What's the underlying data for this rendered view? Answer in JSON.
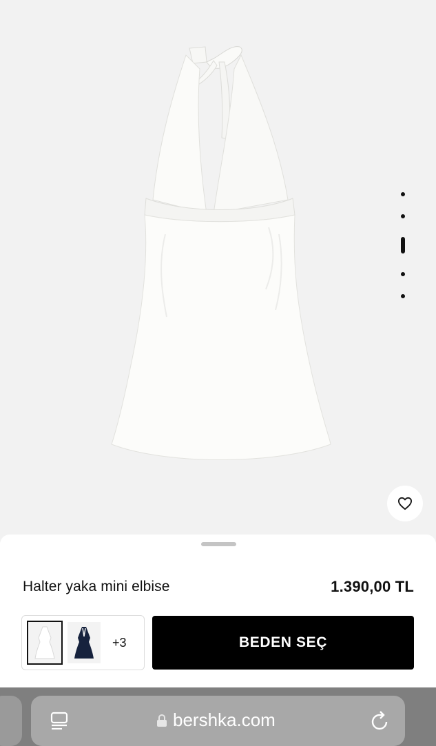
{
  "product": {
    "title": "Halter yaka mini elbise",
    "price": "1.390,00 TL",
    "image_icon": "white-halter-dress-image"
  },
  "gallery": {
    "page_count": 5,
    "active_page": 3
  },
  "favorite": {
    "icon": "heart-icon"
  },
  "variants": {
    "items": [
      {
        "name": "white",
        "color": "#ffffff",
        "selected": true
      },
      {
        "name": "navy",
        "color": "#16223d",
        "selected": false
      }
    ],
    "more_label": "+3"
  },
  "actions": {
    "select_size_label": "BEDEN SEÇ"
  },
  "browser": {
    "url": "bershka.com",
    "icons": [
      "reader-icon",
      "lock-icon",
      "reload-icon"
    ]
  },
  "colors": {
    "background": "#f2f2f2",
    "sheet": "#ffffff",
    "button": "#000000",
    "browser_bar": "#7f7f7f"
  }
}
